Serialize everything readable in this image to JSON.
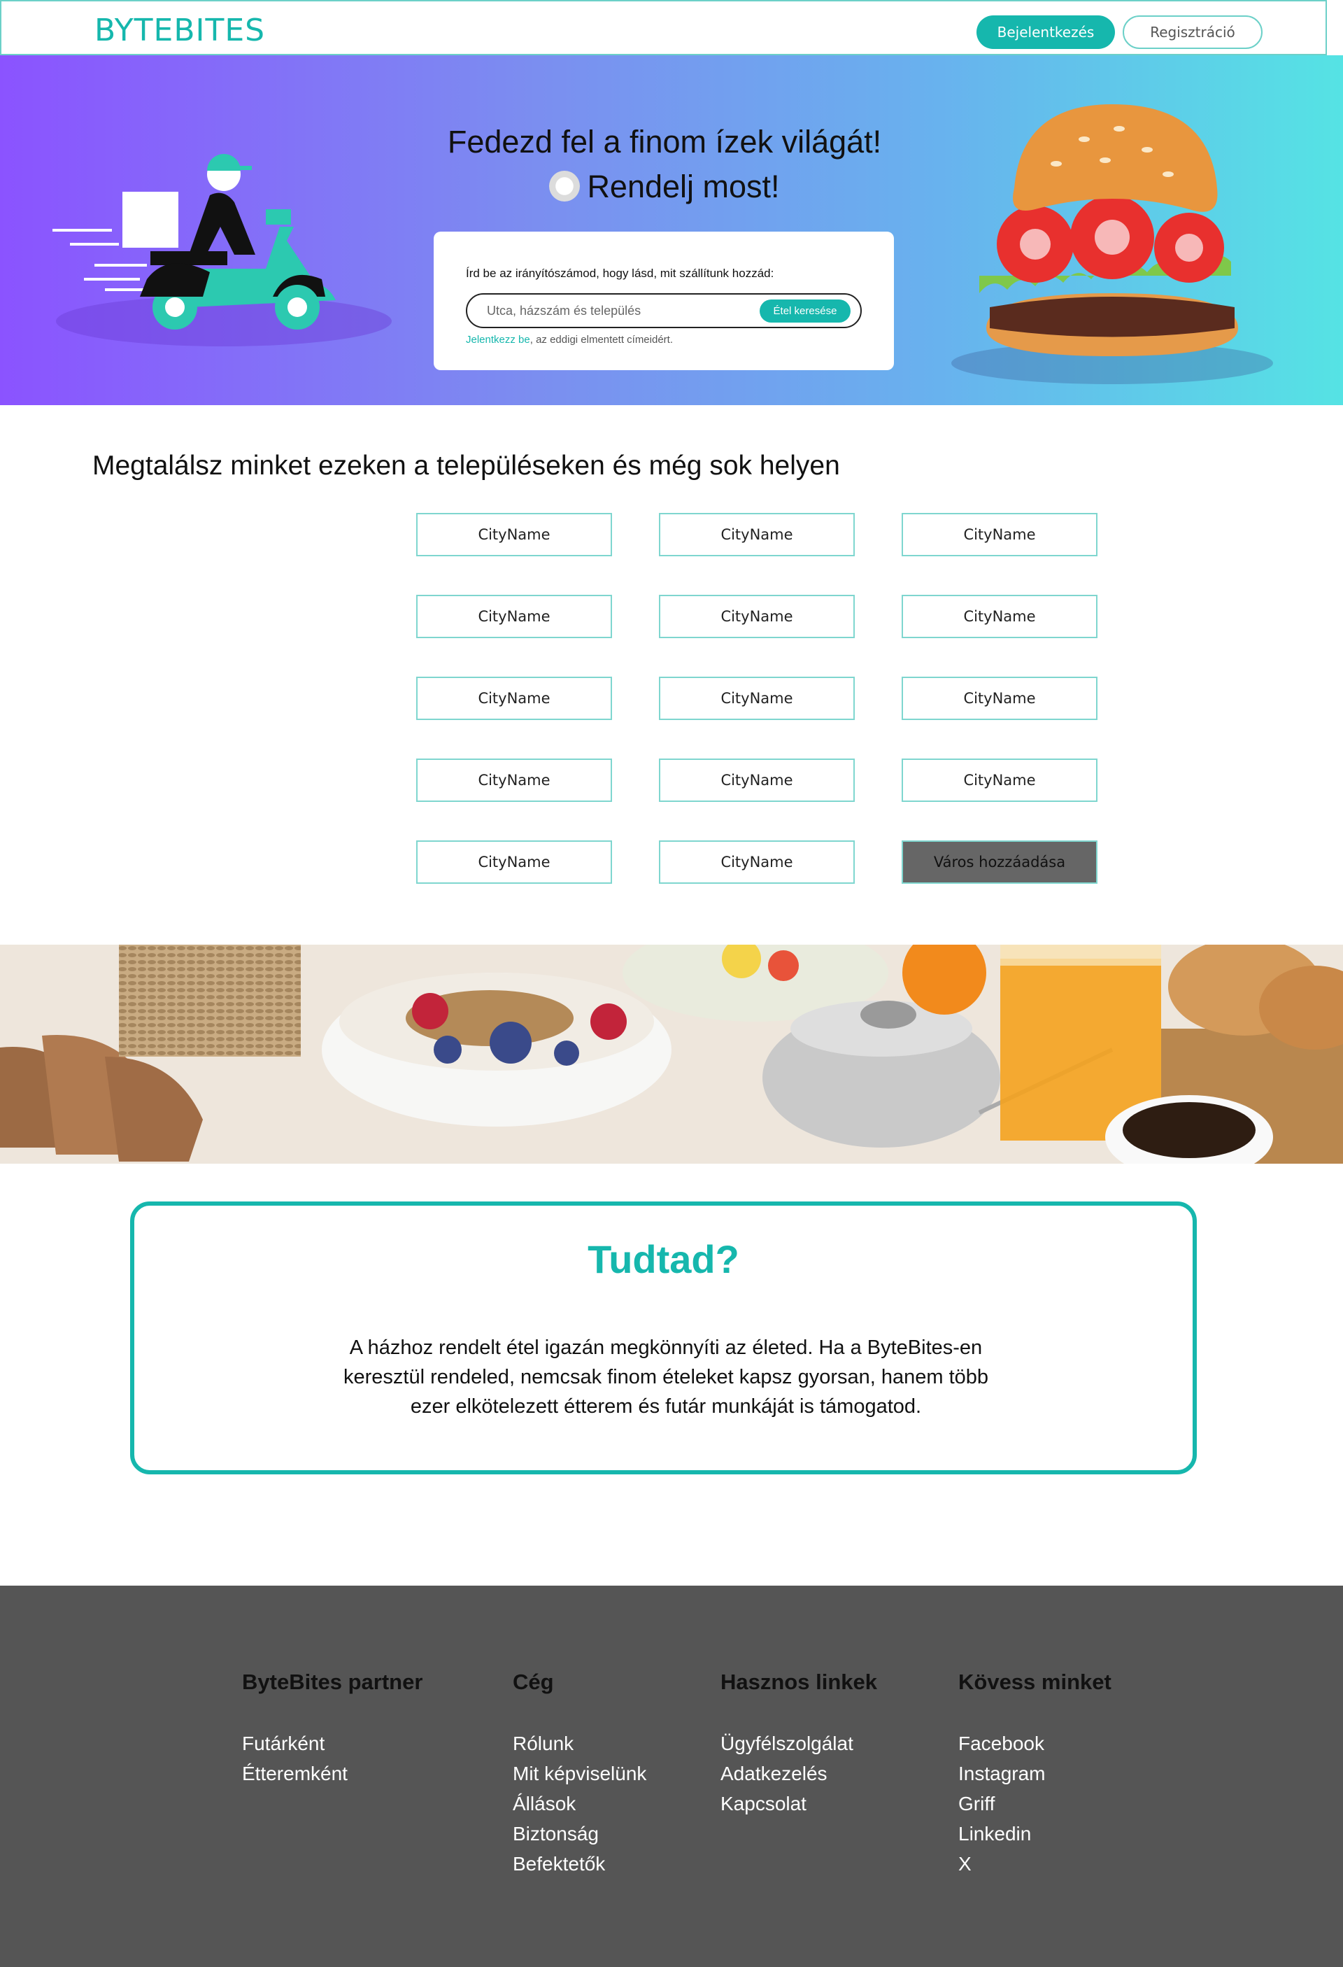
{
  "header": {
    "logo": "BYTEBITES",
    "login_label": "Bejelentkezés",
    "register_label": "Regisztráció"
  },
  "hero": {
    "title_line1": "Fedezd fel a finom ízek világát!",
    "title_line2": "Rendelj most!",
    "search_hint": "Írd be az irányítószámod, hogy lásd, mit szállítunk hozzád:",
    "search_placeholder": "Utca, házszám és település",
    "search_button": "Étel keresése",
    "login_link": "Jelentkezz be",
    "login_note": ", az eddigi elmentett címeidért."
  },
  "cities": {
    "title": "Megtalálsz minket ezeken a településeken és még sok helyen",
    "items": [
      "CityName",
      "CityName",
      "CityName",
      "CityName",
      "CityName",
      "CityName",
      "CityName",
      "CityName",
      "CityName",
      "CityName",
      "CityName",
      "CityName",
      "CityName",
      "CityName"
    ],
    "add_label": "Város hozzáadása"
  },
  "info": {
    "title": "Tudtad?",
    "text": "A házhoz rendelt étel igazán megkönnyíti az életed. Ha a ByteBites-en keresztül rendeled, nemcsak finom ételeket kapsz gyorsan, hanem több ezer elkötelezett étterem és futár munkáját is támogatod."
  },
  "footer": {
    "columns": [
      {
        "title": "ByteBites partner",
        "links": [
          "Futárként",
          "Étteremként"
        ]
      },
      {
        "title": "Cég",
        "links": [
          "Rólunk",
          "Mit képviselünk",
          "Állások",
          "Biztonság",
          "Befektetők"
        ]
      },
      {
        "title": "Hasznos linkek",
        "links": [
          "Ügyfélszolgálat",
          "Adatkezelés",
          "Kapcsolat"
        ]
      },
      {
        "title": "Kövess minket",
        "links": [
          "Facebook",
          "Instagram",
          "Griff",
          "Linkedin",
          "X"
        ]
      }
    ]
  },
  "colors": {
    "accent": "#16b7ad",
    "footer_bg": "#555555",
    "hero_gradient_start": "#8b53ff",
    "hero_gradient_end": "#55e3e4"
  },
  "icons": {
    "hero_left": "delivery-scooter-illustration",
    "hero_right": "burger-illustration",
    "title_emoji": "plate-icon"
  }
}
